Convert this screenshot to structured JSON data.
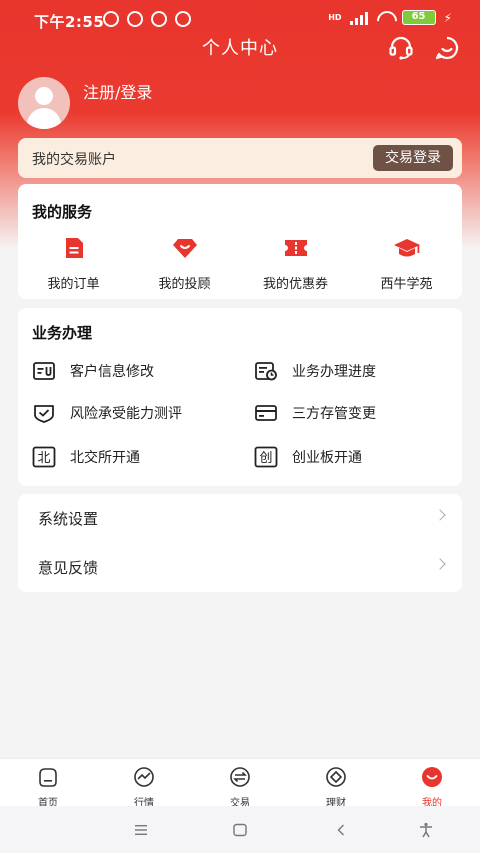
{
  "status_bar": {
    "time": "下午2:55",
    "network": "HD",
    "battery": "65"
  },
  "header": {
    "title": "个人中心"
  },
  "profile": {
    "register_login": "注册/登录"
  },
  "account": {
    "label": "我的交易账户",
    "login_button": "交易登录"
  },
  "services": {
    "title": "我的服务",
    "items": [
      {
        "label": "我的订单",
        "icon": "order-icon"
      },
      {
        "label": "我的投顾",
        "icon": "diamond-icon"
      },
      {
        "label": "我的优惠券",
        "icon": "coupon-icon"
      },
      {
        "label": "西牛学苑",
        "icon": "graduation-cap-icon"
      }
    ]
  },
  "business": {
    "title": "业务办理",
    "items": [
      {
        "label": "客户信息修改",
        "icon": "id-card-icon"
      },
      {
        "label": "业务办理进度",
        "icon": "progress-icon"
      },
      {
        "label": "风险承受能力测评",
        "icon": "shield-check-icon"
      },
      {
        "label": "三方存管变更",
        "icon": "bank-card-icon"
      },
      {
        "label": "北交所开通",
        "icon": "bei-char-icon",
        "glyph": "北"
      },
      {
        "label": "创业板开通",
        "icon": "chuang-char-icon",
        "glyph": "创"
      }
    ]
  },
  "settings": {
    "items": [
      {
        "label": "系统设置"
      },
      {
        "label": "意见反馈"
      }
    ]
  },
  "bottom_nav": {
    "items": [
      {
        "label": "首页",
        "icon": "home-icon"
      },
      {
        "label": "行情",
        "icon": "market-icon"
      },
      {
        "label": "交易",
        "icon": "trade-icon"
      },
      {
        "label": "理财",
        "icon": "wealth-icon"
      },
      {
        "label": "我的",
        "icon": "mine-icon",
        "active": true
      }
    ]
  },
  "colors": {
    "brand_red": "#e8352d",
    "login_button_bg": "#6d5245",
    "account_bar_bg": "#fbeee0"
  }
}
